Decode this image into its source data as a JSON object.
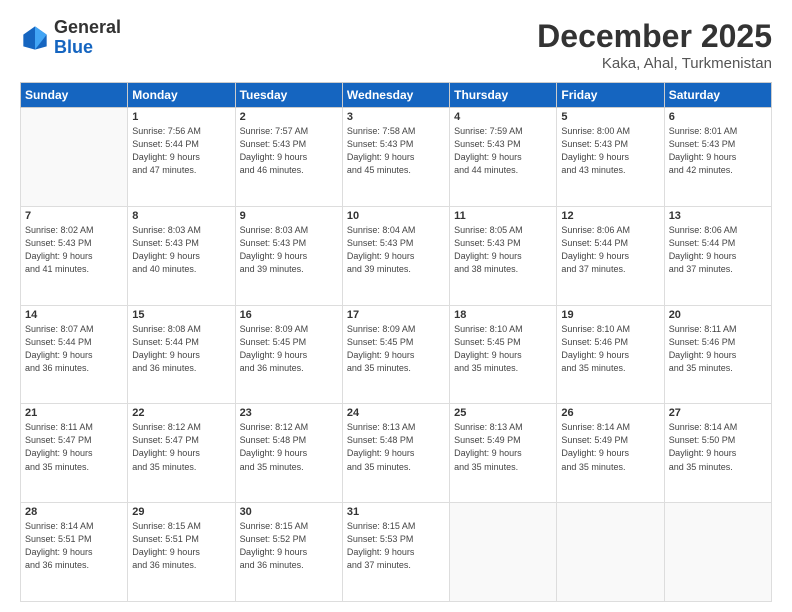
{
  "header": {
    "logo_general": "General",
    "logo_blue": "Blue",
    "month_title": "December 2025",
    "location": "Kaka, Ahal, Turkmenistan"
  },
  "weekdays": [
    "Sunday",
    "Monday",
    "Tuesday",
    "Wednesday",
    "Thursday",
    "Friday",
    "Saturday"
  ],
  "weeks": [
    [
      {
        "day": "",
        "info": ""
      },
      {
        "day": "1",
        "info": "Sunrise: 7:56 AM\nSunset: 5:44 PM\nDaylight: 9 hours\nand 47 minutes."
      },
      {
        "day": "2",
        "info": "Sunrise: 7:57 AM\nSunset: 5:43 PM\nDaylight: 9 hours\nand 46 minutes."
      },
      {
        "day": "3",
        "info": "Sunrise: 7:58 AM\nSunset: 5:43 PM\nDaylight: 9 hours\nand 45 minutes."
      },
      {
        "day": "4",
        "info": "Sunrise: 7:59 AM\nSunset: 5:43 PM\nDaylight: 9 hours\nand 44 minutes."
      },
      {
        "day": "5",
        "info": "Sunrise: 8:00 AM\nSunset: 5:43 PM\nDaylight: 9 hours\nand 43 minutes."
      },
      {
        "day": "6",
        "info": "Sunrise: 8:01 AM\nSunset: 5:43 PM\nDaylight: 9 hours\nand 42 minutes."
      }
    ],
    [
      {
        "day": "7",
        "info": "Sunrise: 8:02 AM\nSunset: 5:43 PM\nDaylight: 9 hours\nand 41 minutes."
      },
      {
        "day": "8",
        "info": "Sunrise: 8:03 AM\nSunset: 5:43 PM\nDaylight: 9 hours\nand 40 minutes."
      },
      {
        "day": "9",
        "info": "Sunrise: 8:03 AM\nSunset: 5:43 PM\nDaylight: 9 hours\nand 39 minutes."
      },
      {
        "day": "10",
        "info": "Sunrise: 8:04 AM\nSunset: 5:43 PM\nDaylight: 9 hours\nand 39 minutes."
      },
      {
        "day": "11",
        "info": "Sunrise: 8:05 AM\nSunset: 5:43 PM\nDaylight: 9 hours\nand 38 minutes."
      },
      {
        "day": "12",
        "info": "Sunrise: 8:06 AM\nSunset: 5:44 PM\nDaylight: 9 hours\nand 37 minutes."
      },
      {
        "day": "13",
        "info": "Sunrise: 8:06 AM\nSunset: 5:44 PM\nDaylight: 9 hours\nand 37 minutes."
      }
    ],
    [
      {
        "day": "14",
        "info": "Sunrise: 8:07 AM\nSunset: 5:44 PM\nDaylight: 9 hours\nand 36 minutes."
      },
      {
        "day": "15",
        "info": "Sunrise: 8:08 AM\nSunset: 5:44 PM\nDaylight: 9 hours\nand 36 minutes."
      },
      {
        "day": "16",
        "info": "Sunrise: 8:09 AM\nSunset: 5:45 PM\nDaylight: 9 hours\nand 36 minutes."
      },
      {
        "day": "17",
        "info": "Sunrise: 8:09 AM\nSunset: 5:45 PM\nDaylight: 9 hours\nand 35 minutes."
      },
      {
        "day": "18",
        "info": "Sunrise: 8:10 AM\nSunset: 5:45 PM\nDaylight: 9 hours\nand 35 minutes."
      },
      {
        "day": "19",
        "info": "Sunrise: 8:10 AM\nSunset: 5:46 PM\nDaylight: 9 hours\nand 35 minutes."
      },
      {
        "day": "20",
        "info": "Sunrise: 8:11 AM\nSunset: 5:46 PM\nDaylight: 9 hours\nand 35 minutes."
      }
    ],
    [
      {
        "day": "21",
        "info": "Sunrise: 8:11 AM\nSunset: 5:47 PM\nDaylight: 9 hours\nand 35 minutes."
      },
      {
        "day": "22",
        "info": "Sunrise: 8:12 AM\nSunset: 5:47 PM\nDaylight: 9 hours\nand 35 minutes."
      },
      {
        "day": "23",
        "info": "Sunrise: 8:12 AM\nSunset: 5:48 PM\nDaylight: 9 hours\nand 35 minutes."
      },
      {
        "day": "24",
        "info": "Sunrise: 8:13 AM\nSunset: 5:48 PM\nDaylight: 9 hours\nand 35 minutes."
      },
      {
        "day": "25",
        "info": "Sunrise: 8:13 AM\nSunset: 5:49 PM\nDaylight: 9 hours\nand 35 minutes."
      },
      {
        "day": "26",
        "info": "Sunrise: 8:14 AM\nSunset: 5:49 PM\nDaylight: 9 hours\nand 35 minutes."
      },
      {
        "day": "27",
        "info": "Sunrise: 8:14 AM\nSunset: 5:50 PM\nDaylight: 9 hours\nand 35 minutes."
      }
    ],
    [
      {
        "day": "28",
        "info": "Sunrise: 8:14 AM\nSunset: 5:51 PM\nDaylight: 9 hours\nand 36 minutes."
      },
      {
        "day": "29",
        "info": "Sunrise: 8:15 AM\nSunset: 5:51 PM\nDaylight: 9 hours\nand 36 minutes."
      },
      {
        "day": "30",
        "info": "Sunrise: 8:15 AM\nSunset: 5:52 PM\nDaylight: 9 hours\nand 36 minutes."
      },
      {
        "day": "31",
        "info": "Sunrise: 8:15 AM\nSunset: 5:53 PM\nDaylight: 9 hours\nand 37 minutes."
      },
      {
        "day": "",
        "info": ""
      },
      {
        "day": "",
        "info": ""
      },
      {
        "day": "",
        "info": ""
      }
    ]
  ]
}
